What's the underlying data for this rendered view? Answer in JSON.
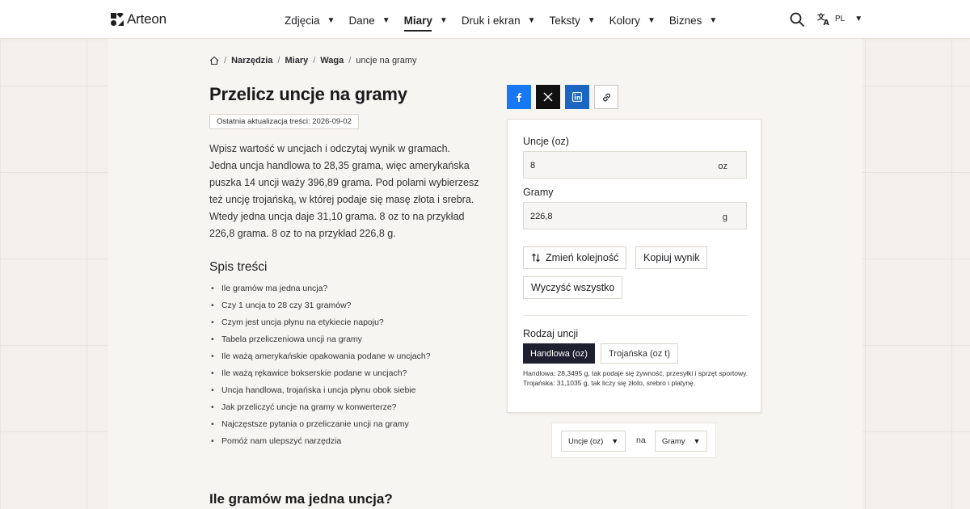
{
  "header": {
    "logo_text": "Arteon",
    "nav": [
      {
        "label": "Zdjęcia"
      },
      {
        "label": "Dane"
      },
      {
        "label": "Miary"
      },
      {
        "label": "Druk i ekran"
      },
      {
        "label": "Teksty"
      },
      {
        "label": "Kolory"
      },
      {
        "label": "Biznes"
      }
    ],
    "active_nav": "Miary",
    "lang": "PL"
  },
  "breadcrumb": {
    "items": [
      "Narzędzia",
      "Miary",
      "Waga"
    ],
    "current": "uncje na gramy"
  },
  "page": {
    "title": "Przelicz uncje na gramy",
    "updated": "Ostatnia aktualizacja treści: 2026-09-02",
    "intro": "Wpisz wartość w uncjach i odczytaj wynik w gramach. Jedna uncja handlowa to 28,35 grama, więc amerykańska puszka 14 uncji waży 396,89 grama. Pod polami wybierzesz też uncję trojańską, w której podaje się masę złota i srebra. Wtedy jedna uncja daje 31,10 grama. 8 oz to na przykład 226,8 grama. 8 oz to na przykład 226,8 g.",
    "toc_title": "Spis treści",
    "toc": [
      "Ile gramów ma jedna uncja?",
      "Czy 1 uncja to 28 czy 31 gramów?",
      "Czym jest uncja płynu na etykiecie napoju?",
      "Tabela przeliczeniowa uncji na gramy",
      "Ile ważą amerykańskie opakowania podane w uncjach?",
      "Ile ważą rękawice bokserskie podane w uncjach?",
      "Uncja handlowa, trojańska i uncja płynu obok siebie",
      "Jak przeliczyć uncje na gramy w konwerterze?",
      "Najczęstsze pytania o przeliczanie uncji na gramy",
      "Pomóż nam ulepszyć narzędzia"
    ],
    "section_heading": "Ile gramów ma jedna uncja?"
  },
  "converter": {
    "input_label": "Uncje (oz)",
    "input_value": "8",
    "input_unit": "oz",
    "output_label": "Gramy",
    "output_value": "226,8",
    "output_unit": "g",
    "swap_label": "Zmień kolejność",
    "copy_label": "Kopiuj wynik",
    "clear_label": "Wyczyść wszystko",
    "unit_type_label": "Rodzaj uncji",
    "unit_type_options": [
      "Handlowa (oz)",
      "Trojańska (oz t)"
    ],
    "unit_type_selected": "Handlowa (oz)",
    "note": "Handlowa: 28,3495 g, tak podaje się żywność, przesyłki i sprzęt sportowy. Trojańska: 31,1035 g, tak liczy się złoto, srebro i platynę."
  },
  "unit_selector": {
    "from": "Uncje (oz)",
    "to_word": "na",
    "to": "Gramy"
  },
  "colors": {
    "accent_dark": "#1e2030",
    "facebook": "#1877f2",
    "linkedin": "#1a66c2",
    "x": "#111111"
  }
}
